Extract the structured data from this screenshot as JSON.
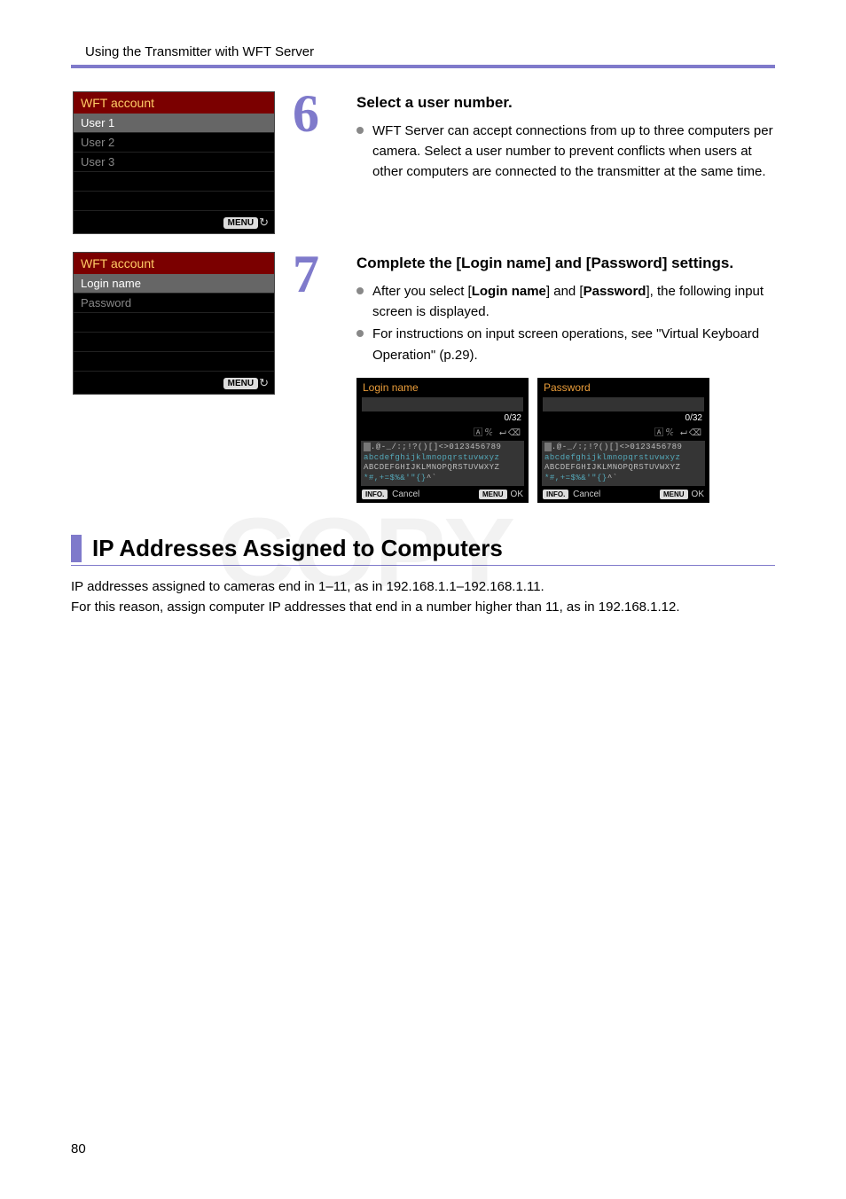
{
  "header": "Using the Transmitter with WFT Server",
  "step6": {
    "num": "6",
    "title": "Select a user number.",
    "bullet": "WFT Server can accept connections from up to three computers per camera. Select a user number to prevent conflicts when users at other computers are connected to the transmitter at the same time.",
    "screen": {
      "title": "WFT account",
      "rows": [
        "User 1",
        "User 2",
        "User 3"
      ],
      "menu": "MENU"
    }
  },
  "step7": {
    "num": "7",
    "title": "Complete the [Login name] and [Password] settings.",
    "bullets": {
      "b1_prefix": "After you select [",
      "b1_bold1": "Login name",
      "b1_mid": "] and [",
      "b1_bold2": "Password",
      "b1_suffix": "], the following input screen is displayed.",
      "b2": "For instructions on input screen operations, see \"Virtual Keyboard Operation\" (p.29)."
    },
    "screen": {
      "title": "WFT account",
      "rows": [
        "Login name",
        "Password"
      ],
      "menu": "MENU"
    },
    "kb": {
      "login_title": "Login name",
      "password_title": "Password",
      "count": "0/32",
      "chars_line1": ".@-_/:;!?()[]<>0123456789",
      "chars_line2": "abcdefghijklmnopqrstuvwxyz",
      "chars_line3": "ABCDEFGHIJKLMNOPQRSTUVWXYZ",
      "chars_line4": "*#,+=$%&'\"{}^",
      "info": "INFO.",
      "cancel": "Cancel",
      "menu": "MENU",
      "ok": "OK"
    }
  },
  "section": {
    "heading": "IP Addresses Assigned to Computers",
    "p1": "IP addresses assigned to cameras end in 1–11, as in 192.168.1.1–192.168.1.11.",
    "p2": "For this reason, assign computer IP addresses that end in a number higher than 11, as in 192.168.1.12."
  },
  "page_number": "80",
  "watermark": "COPY"
}
